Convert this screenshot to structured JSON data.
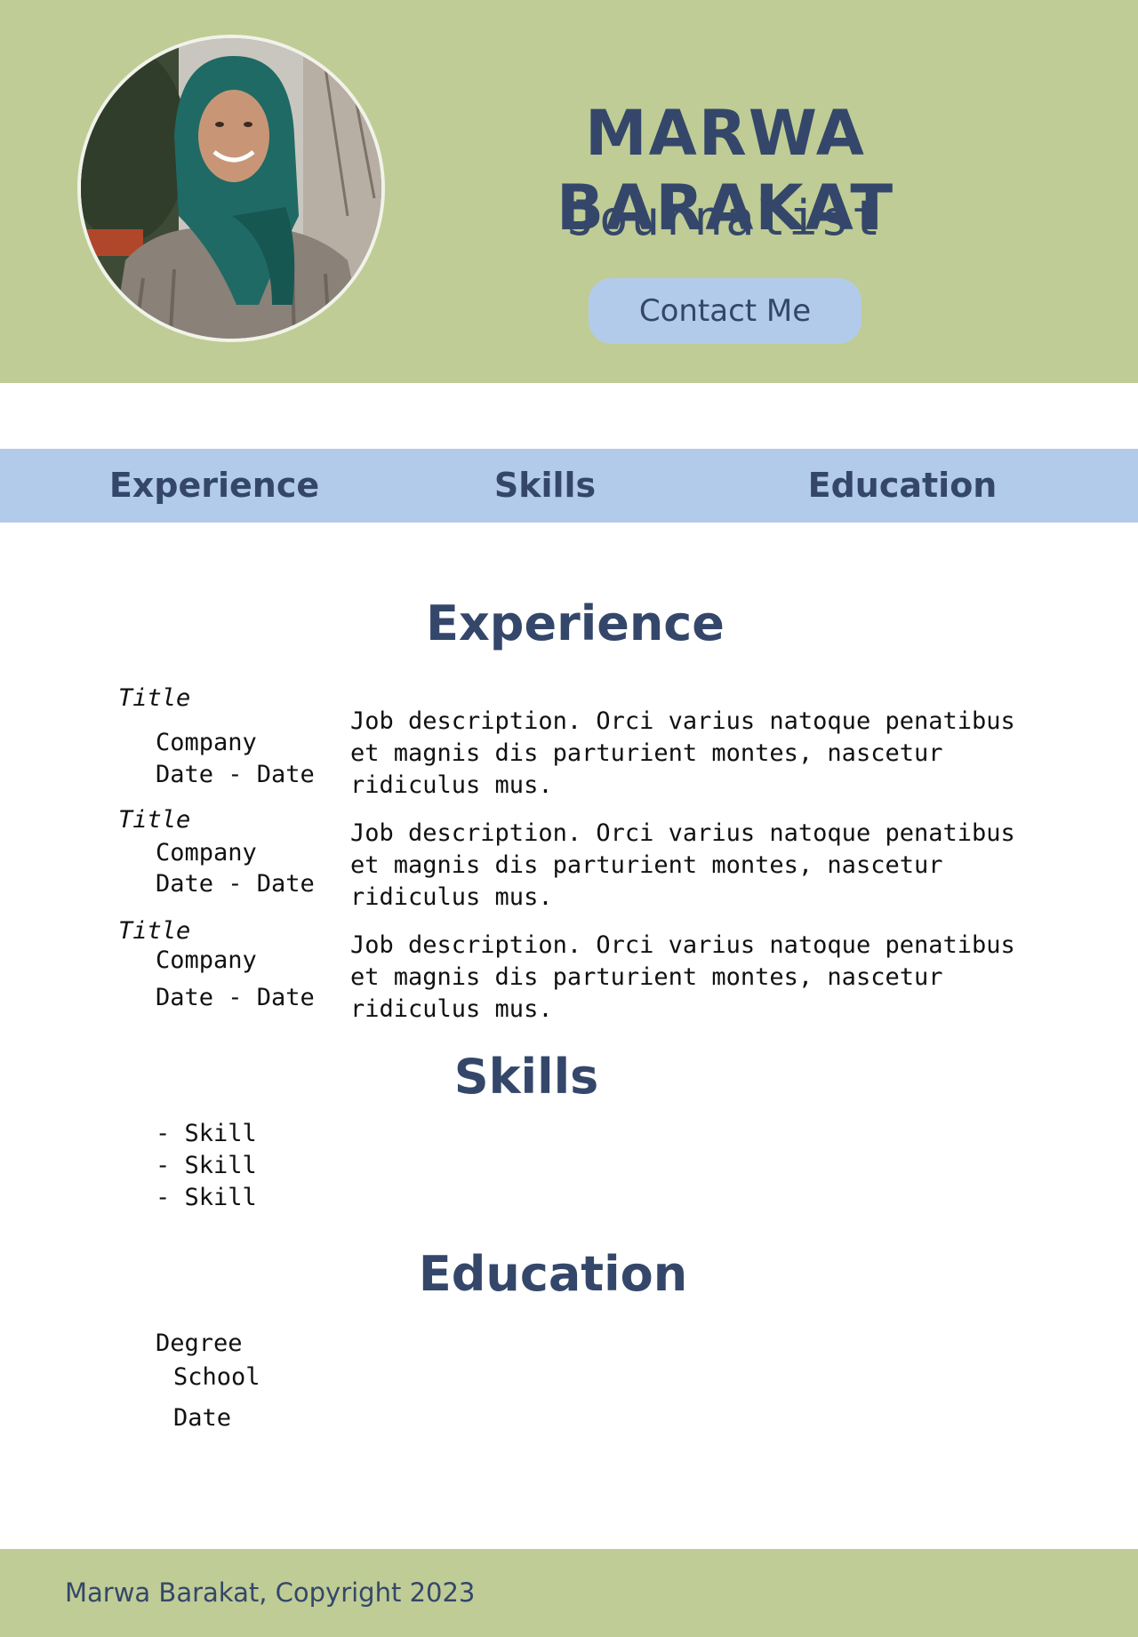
{
  "header": {
    "name": "MARWA BARAKAT",
    "job_title": "Journalist",
    "contact_button": "Contact Me"
  },
  "nav": {
    "items": [
      {
        "label": "Experience"
      },
      {
        "label": "Skills"
      },
      {
        "label": "Education"
      }
    ]
  },
  "experience": {
    "heading": "Experience",
    "entries": [
      {
        "title": "Title",
        "company": "Company",
        "dates": "Date - Date",
        "description": "Job description. Orci varius natoque penatibus et magnis dis parturient montes, nascetur ridiculus mus."
      },
      {
        "title": "Title",
        "company": "Company",
        "dates": "Date - Date",
        "description": "Job description. Orci varius natoque penatibus et magnis dis parturient montes, nascetur ridiculus mus."
      },
      {
        "title": "Title",
        "company": "Company",
        "dates": "Date - Date",
        "description": "Job description. Orci varius natoque penatibus et magnis dis parturient montes, nascetur ridiculus mus."
      }
    ]
  },
  "skills": {
    "heading": "Skills",
    "items": [
      "- Skill",
      "- Skill",
      "- Skill"
    ]
  },
  "education": {
    "heading": "Education",
    "degree": "Degree",
    "school": "School",
    "date": "Date"
  },
  "footer": {
    "text": "Marwa Barakat, Copyright 2023"
  },
  "colors": {
    "header_bg": "#bfcc95",
    "nav_bg": "#b3cbea",
    "button_bg": "#b3cbea",
    "heading_text": "#34476a",
    "body_text": "#111111"
  }
}
